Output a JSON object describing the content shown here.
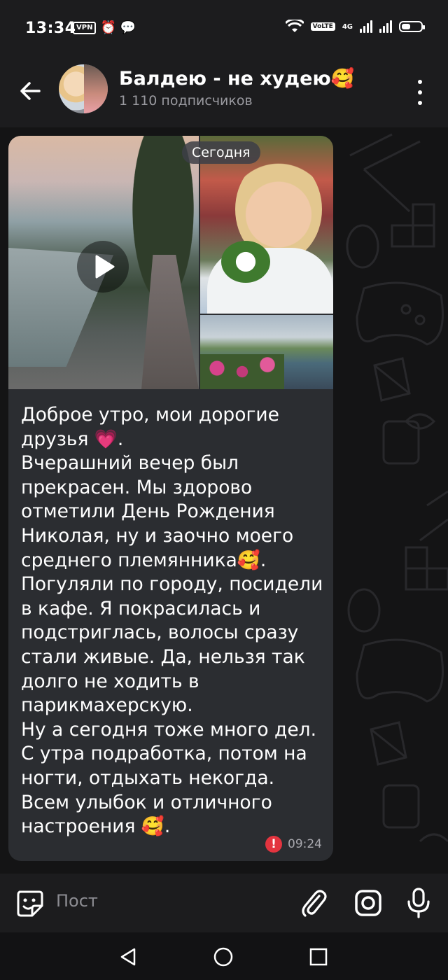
{
  "status_bar": {
    "time": "13:34",
    "vpn": "VPN",
    "volte": "VoLTE",
    "network": "4G",
    "battery_level": 0.45
  },
  "header": {
    "title": "Балдею - не худею🥰",
    "subscribers": "1 110 подписчиков"
  },
  "message": {
    "date_pill": "Сегодня",
    "text": "Доброе утро, мои дорогие друзья 💗.\nВчерашний вечер был прекрасен. Мы здорово отметили День Рождения Николая, ну и заочно моего среднего племянника🥰.\nПогуляли по городу, посидели в кафе. Я покрасилась и подстриглась, волосы сразу стали живые. Да, нельзя так долго не ходить в парикмахерскую.\nНу а сегодня тоже много дел. С утра подработка, потом на ногти, отдыхать некогда.\nВсем улыбок и отличного настроения 🥰.",
    "time": "09:24",
    "error_mark": "!"
  },
  "input_bar": {
    "placeholder": "Пост"
  },
  "icons": {
    "back": "arrow-left-icon",
    "more": "more-vert-icon",
    "play": "play-icon",
    "emoji": "sticker-icon",
    "attach": "paperclip-icon",
    "camera": "camera-icon",
    "mic": "mic-icon"
  },
  "colors": {
    "bubble": "#2b2d31",
    "error": "#e3343f",
    "header": "#1c1c1e"
  }
}
